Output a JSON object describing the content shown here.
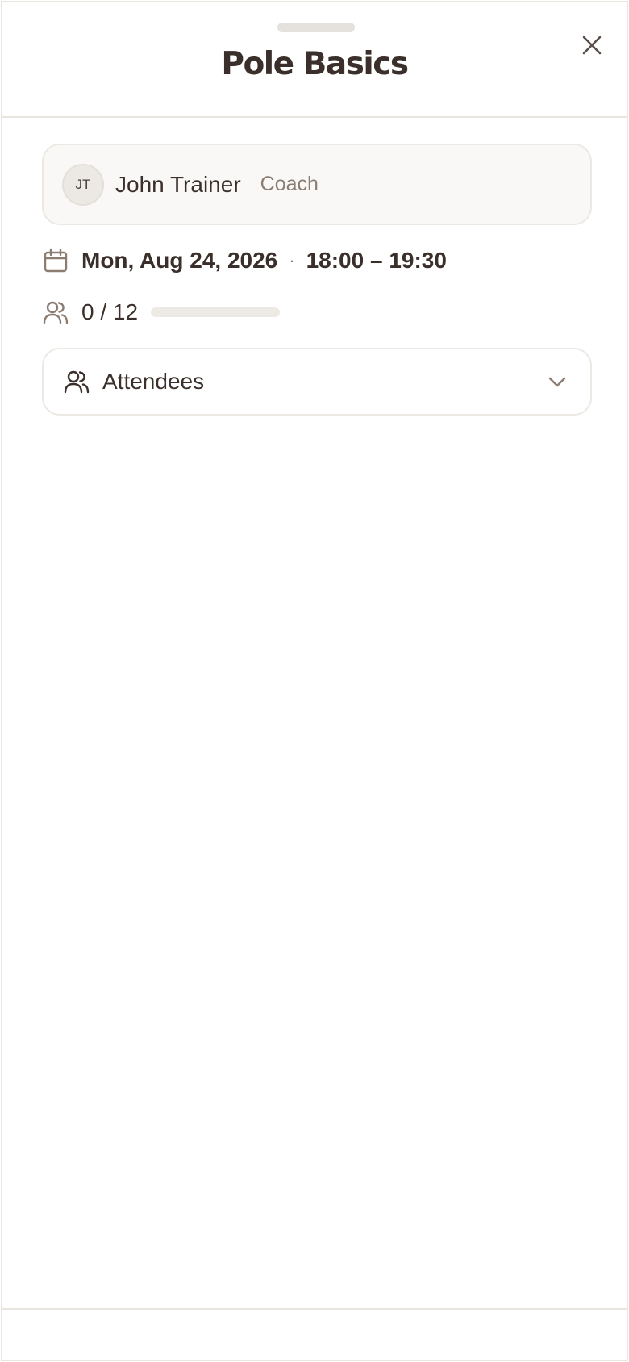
{
  "sheet": {
    "title": "Pole Basics",
    "close_icon": "close-icon"
  },
  "coach": {
    "initials": "JT",
    "name": "John Trainer",
    "role": "Coach"
  },
  "schedule": {
    "icon": "calendar-icon",
    "date": "Mon, Aug 24, 2026",
    "separator": "·",
    "time": "18:00 – 19:30"
  },
  "capacity": {
    "icon": "users-icon",
    "label": "0 / 12",
    "booked": 0,
    "max": 12,
    "fill_fraction": 0
  },
  "attendees": {
    "icon": "users-icon",
    "label": "Attendees",
    "toggle_icon": "chevron-down-icon"
  },
  "colors": {
    "text": "#3a2f2a",
    "muted": "#8c7d73",
    "border": "#e9e5df",
    "card_bg": "#f9f8f6"
  }
}
